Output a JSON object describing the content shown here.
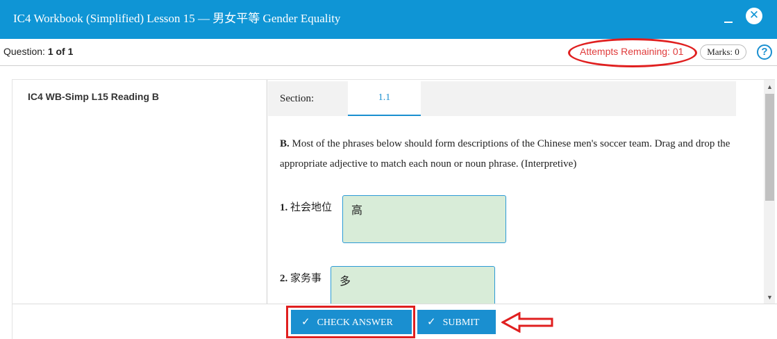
{
  "window": {
    "title": "IC4 Workbook (Simplified) Lesson 15 — 男女平等 Gender Equality",
    "minimize_icon": "minimize-icon",
    "close_icon": "close-icon"
  },
  "question_bar": {
    "question_prefix": "Question:",
    "question_value": "1 of 1",
    "attempts_text": "Attempts Remaining: 01",
    "marks_text": "Marks: 0",
    "help_icon": "?"
  },
  "left_pane": {
    "question_name": "IC4 WB-Simp L15 Reading B"
  },
  "section": {
    "label": "Section:",
    "tabs": [
      {
        "label": "1.1",
        "active": true
      }
    ]
  },
  "instructions": {
    "prefix": "B.",
    "text": "Most of the phrases below should form descriptions of the Chinese men's soccer team. Drag and drop the appropriate adjective to match each noun or noun phrase. (Interpretive)"
  },
  "items": [
    {
      "number": "1.",
      "noun": "社会地位",
      "answer": "高"
    },
    {
      "number": "2.",
      "noun": "家务事",
      "answer": "多"
    }
  ],
  "footer": {
    "check_answer_label": "CHECK ANSWER",
    "submit_label": "SUBMIT",
    "check_icon": "✓"
  },
  "colors": {
    "header_bg": "#0f95d5",
    "accent": "#1a8fd0",
    "attempts_text": "#e03b3b",
    "annotation_red": "#e01f1f",
    "drop_zone_bg": "#d8ecd8"
  }
}
